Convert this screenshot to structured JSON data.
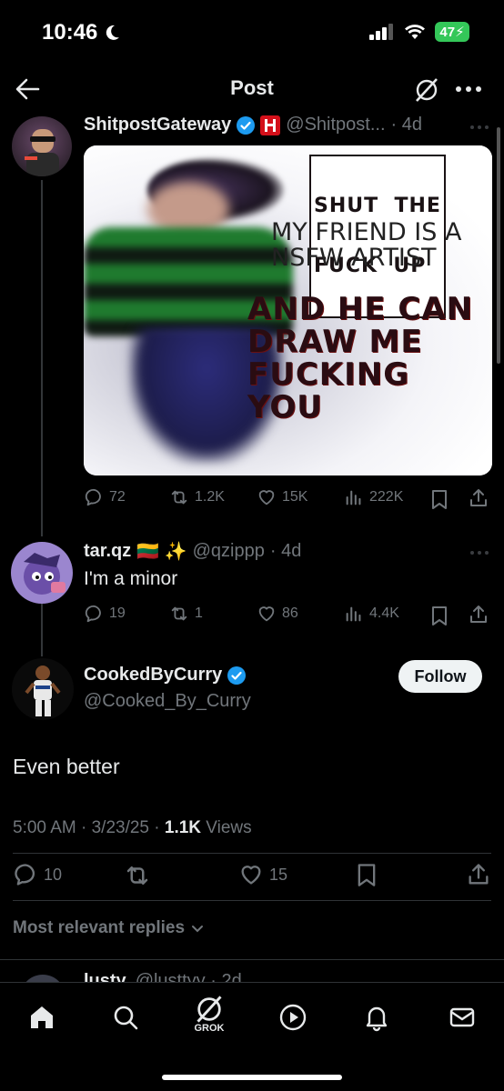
{
  "status_bar": {
    "time": "10:46",
    "battery": "47"
  },
  "top_bar": {
    "title": "Post"
  },
  "quoted_thread": [
    {
      "name": "ShitpostGateway",
      "handle": "@Shitpost...",
      "time": "· 4d",
      "meme_text": {
        "line1": "SHUT  THE",
        "line2": "FUCK  UP",
        "line3": "MY FRIEND IS A",
        "line4": "NSFW ARTIST",
        "line5": "AND HE CAN",
        "line6": "DRAW ME",
        "line7": "FUCKING",
        "line8": "YOU"
      },
      "stats": {
        "replies": "72",
        "reposts": "1.2K",
        "likes": "15K",
        "views": "222K"
      }
    },
    {
      "name": "tar.qz",
      "emoji": "🇱🇹 ✨",
      "handle": "@qzippp",
      "time": "· 4d",
      "text": "I'm a minor",
      "stats": {
        "replies": "19",
        "reposts": "1",
        "likes": "86",
        "views": "4.4K"
      }
    }
  ],
  "main_post": {
    "name": "CookedByCurry",
    "handle": "@Cooked_By_Curry",
    "follow_label": "Follow",
    "text": "Even better",
    "timestamp": "5:00 AM · 3/23/25 · ",
    "views_count": "1.1K",
    "views_label": " Views",
    "stats": {
      "replies": "10",
      "likes": "15"
    }
  },
  "replies_sort": {
    "label": "Most relevant replies"
  },
  "next_reply_partial": {
    "name": "lusty",
    "handle": "@lusttyy · 2d"
  },
  "bottom_nav": {
    "grok_label": "GROK"
  },
  "colors": {
    "accent": "#1d9bf0",
    "background": "#000000",
    "muted": "#71767b",
    "battery": "#34c759"
  }
}
